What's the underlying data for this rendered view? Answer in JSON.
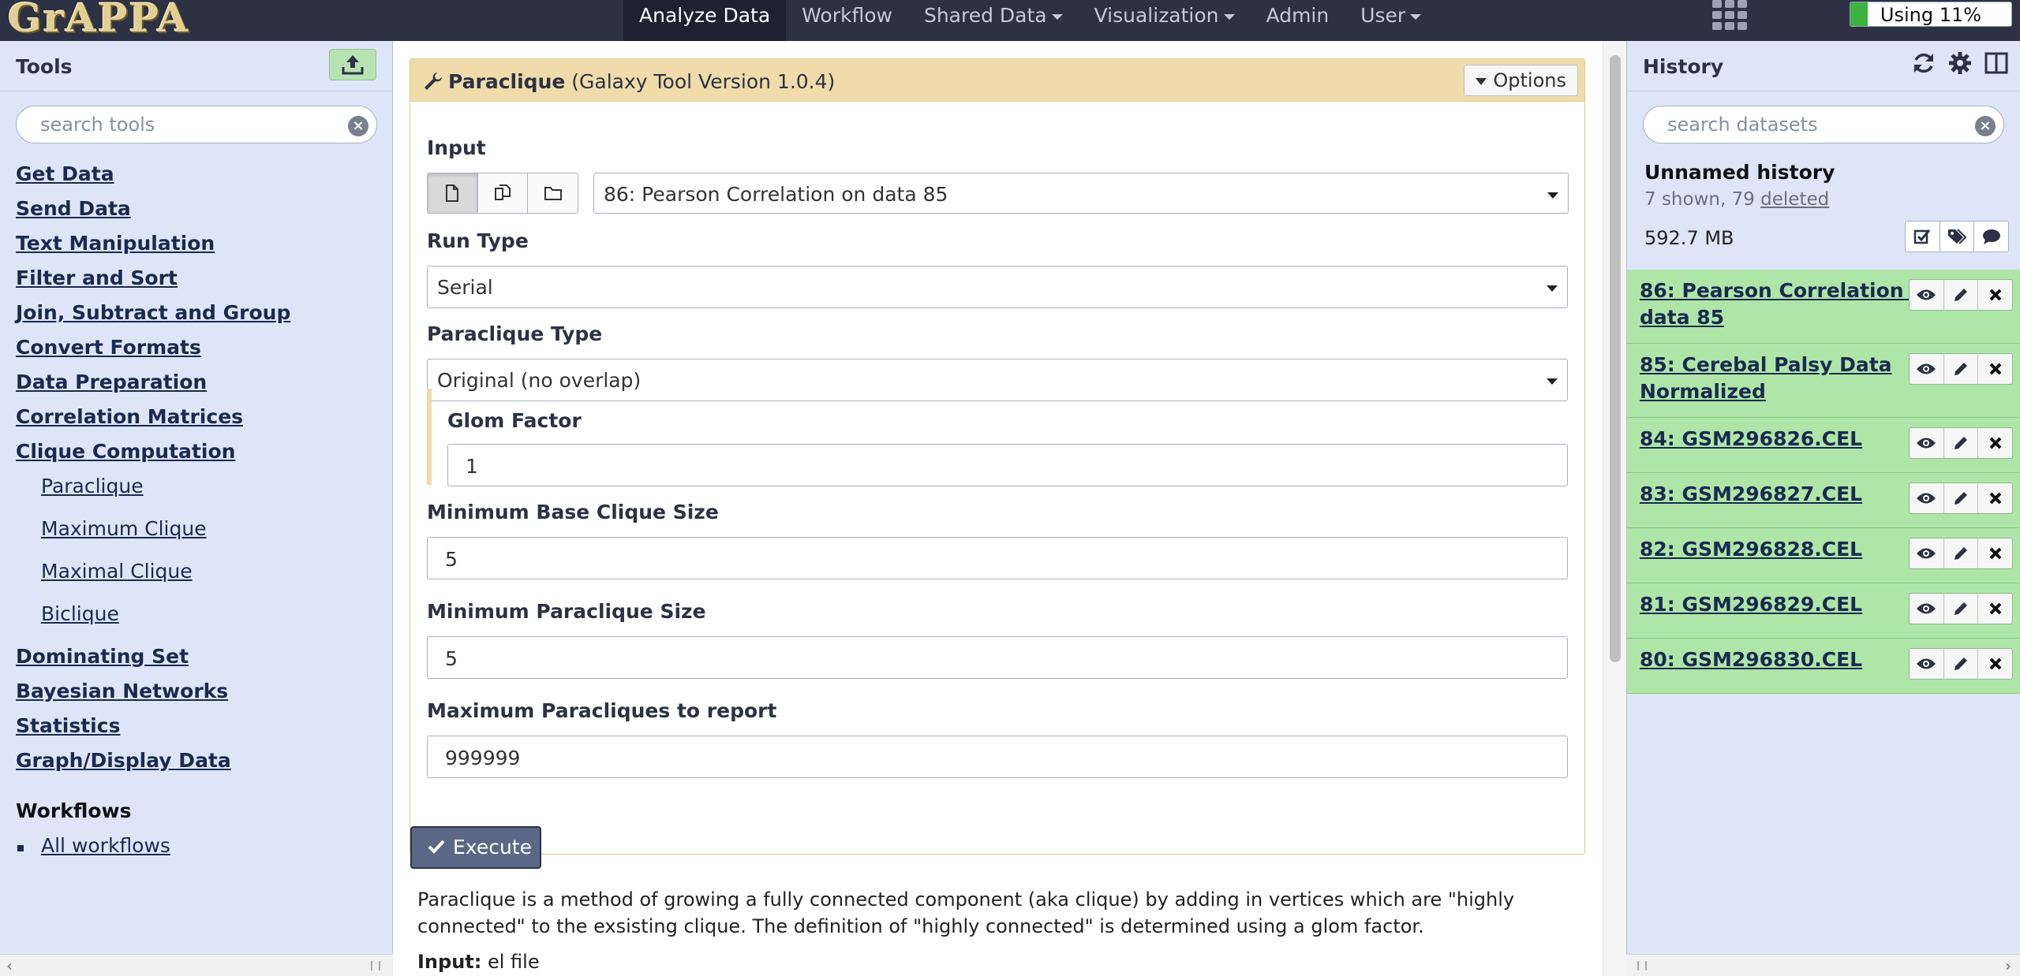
{
  "app": {
    "brand": "GrAPPA"
  },
  "nav": {
    "items": [
      {
        "label": "Analyze Data",
        "active": true,
        "dropdown": false
      },
      {
        "label": "Workflow",
        "active": false,
        "dropdown": false
      },
      {
        "label": "Shared Data",
        "active": false,
        "dropdown": true
      },
      {
        "label": "Visualization",
        "active": false,
        "dropdown": true
      },
      {
        "label": "Admin",
        "active": false,
        "dropdown": false
      },
      {
        "label": "User",
        "active": false,
        "dropdown": true
      }
    ],
    "quota_label": "Using 11%",
    "quota_fraction": 0.11
  },
  "tools": {
    "title": "Tools",
    "search_placeholder": "search tools",
    "sections": [
      "Get Data",
      "Send Data",
      "Text Manipulation",
      "Filter and Sort",
      "Join, Subtract and Group",
      "Convert Formats",
      "Data Preparation",
      "Correlation Matrices",
      "Clique Computation"
    ],
    "clique_tools": [
      "Paraclique",
      "Maximum Clique",
      "Maximal Clique",
      "Biclique"
    ],
    "sections_after": [
      "Dominating Set",
      "Bayesian Networks",
      "Statistics",
      "Graph/Display Data"
    ],
    "workflows_heading": "Workflows",
    "all_workflows": "All workflows"
  },
  "form": {
    "tool_name": "Paraclique",
    "tool_version": "(Galaxy Tool Version 1.0.4)",
    "options_label": "Options",
    "input_label": "Input",
    "input_value": "86: Pearson Correlation on data 85",
    "run_type_label": "Run Type",
    "run_type_value": "Serial",
    "paraclique_type_label": "Paraclique Type",
    "paraclique_type_value": "Original (no overlap)",
    "glom_label": "Glom Factor",
    "glom_value": "1",
    "min_base_label": "Minimum Base Clique Size",
    "min_base_value": "5",
    "min_para_label": "Minimum Paraclique Size",
    "min_para_value": "5",
    "max_report_label": "Maximum Paracliques to report",
    "max_report_value": "999999",
    "execute_label": "Execute"
  },
  "help": {
    "paragraph": "Paraclique is a method of growing a fully connected component (aka clique) by adding in vertices which are \"highly connected\" to the exsisting clique. The definition of \"highly connected\" is determined using a glom factor.",
    "input_label": "Input:",
    "input_text": " el file"
  },
  "history": {
    "title": "History",
    "search_placeholder": "search datasets",
    "name": "Unnamed history",
    "count_text": "7 shown, 79 ",
    "deleted_link": "deleted",
    "size": "592.7 MB",
    "datasets": [
      "86: Pearson Correlation on data 85",
      "85: Cerebal Palsy Data Normalized",
      "84: GSM296826.CEL",
      "83: GSM296827.CEL",
      "82: GSM296828.CEL",
      "81: GSM296829.CEL",
      "80: GSM296830.CEL"
    ]
  },
  "colors": {
    "masthead": "#2c3143",
    "panel_bg": "#dfe5f9",
    "dataset_ok": "#aee6a8",
    "form_header": "#efdcaa",
    "quota_fill": "#3cb33c"
  }
}
